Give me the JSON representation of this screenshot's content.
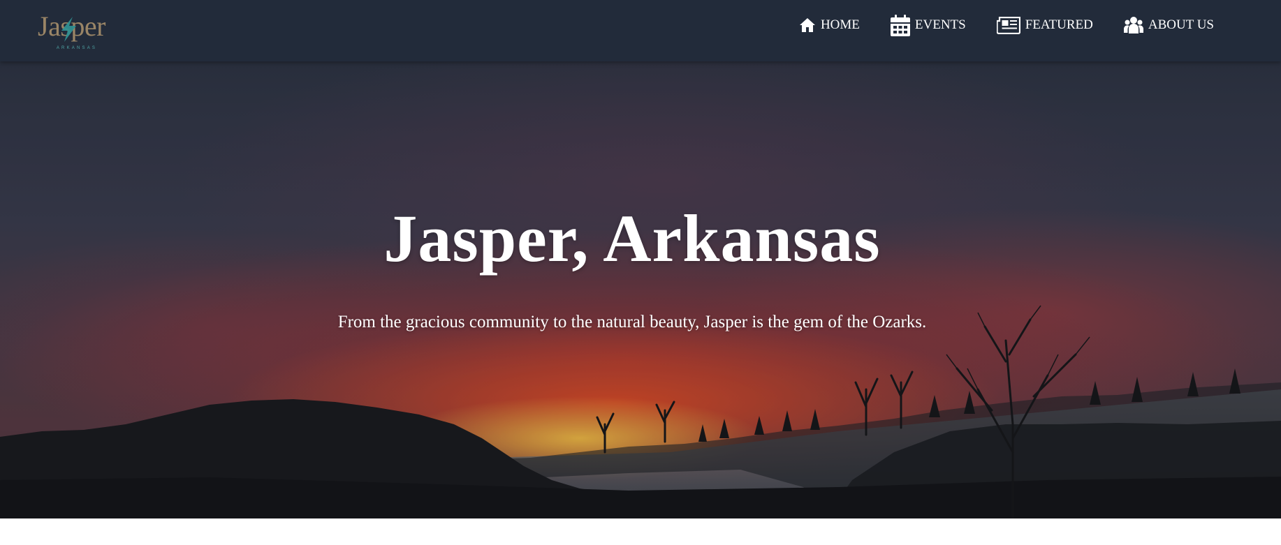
{
  "logo": {
    "wordmark": "Jasper",
    "subline": "ARKANSAS",
    "icon": "lightning-bolt-icon"
  },
  "nav": {
    "items": [
      {
        "label": "HOME",
        "icon": "home-icon"
      },
      {
        "label": "EVENTS",
        "icon": "calendar-icon"
      },
      {
        "label": "FEATURED",
        "icon": "newspaper-icon"
      },
      {
        "label": "ABOUT US",
        "icon": "users-icon"
      }
    ]
  },
  "hero": {
    "title": "Jasper, Arkansas",
    "subtitle": "From the gracious community to the natural beauty, Jasper is the gem of the Ozarks."
  },
  "colors": {
    "navbar_bg": "#222b3a",
    "logo_gold": "#9a8566",
    "logo_teal": "#4fa6a6",
    "sunset_orange": "#e84e24"
  }
}
